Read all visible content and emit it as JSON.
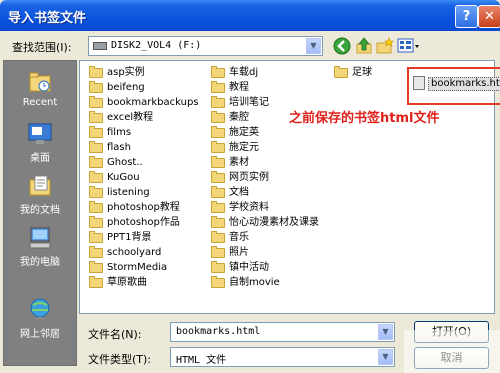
{
  "window": {
    "title": "导入书签文件",
    "help_label": "?",
    "close_label": "✕"
  },
  "toolbar": {
    "lookin_label": "查找范围(I):",
    "lookin_value": "DISK2_VOL4 (F:)",
    "icons": [
      "back-icon",
      "up-folder-icon",
      "new-folder-icon",
      "view-menu-icon"
    ]
  },
  "places": [
    {
      "label": "Recent",
      "icon": "recent-icon"
    },
    {
      "label": "桌面",
      "icon": "desktop-icon"
    },
    {
      "label": "我的文档",
      "icon": "my-documents-icon"
    },
    {
      "label": "我的电脑",
      "icon": "my-computer-icon"
    },
    {
      "label": "网上邻居",
      "icon": "network-icon"
    }
  ],
  "files": {
    "col1": [
      "asp实例",
      "beifeng",
      "bookmarkbackups",
      "excel教程",
      "films",
      "flash",
      "Ghost..",
      "KuGou",
      "listening",
      "photoshop教程",
      "photoshop作品",
      "PPT1背景",
      "schoolyard",
      "StormMedia",
      "草原歌曲"
    ],
    "col2": [
      "车载dj",
      "教程",
      "培训笔记",
      "秦腔",
      "施定英",
      "施定元",
      "素材",
      "网页实例",
      "文档",
      "学校资料",
      "怡心动漫素材及课录",
      "音乐",
      "照片",
      "镇中活动",
      "自制movie"
    ],
    "col3_folder": "足球",
    "col3_file": "bookmarks.html"
  },
  "annotation": "之前保存的书签html文件",
  "form": {
    "filename_label": "文件名(N):",
    "filename_value": "bookmarks.html",
    "filetype_label": "文件类型(T):",
    "filetype_value": "HTML 文件",
    "open_label": "打开(O)",
    "cancel_label": "取消"
  }
}
